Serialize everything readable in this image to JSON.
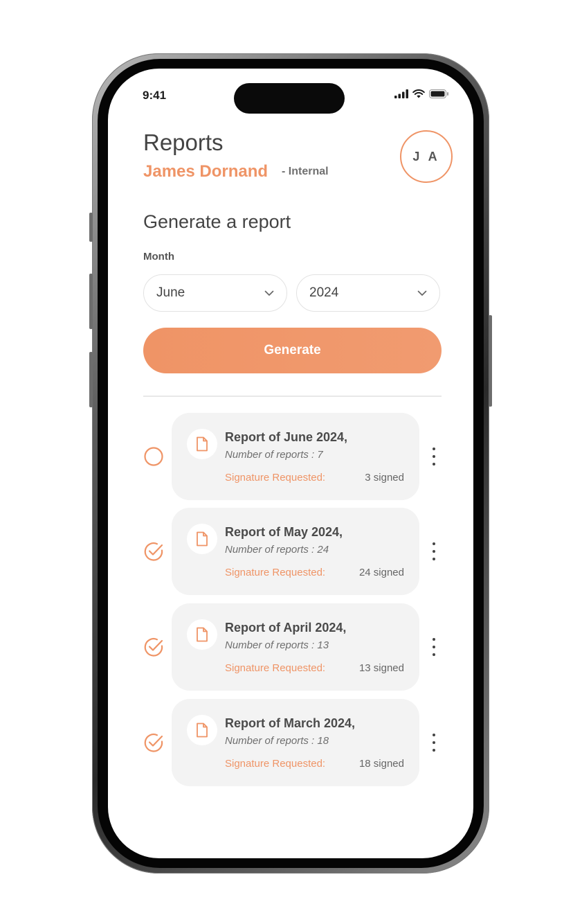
{
  "status_bar": {
    "time": "9:41"
  },
  "header": {
    "title": "Reports",
    "user_name": "James Dornand",
    "user_role": "- Internal",
    "avatar_initials": "J A"
  },
  "generate": {
    "section_title": "Generate a report",
    "month_label": "Month",
    "month_value": "June",
    "year_value": "2024",
    "button_label": "Generate"
  },
  "reports": [
    {
      "title": "Report of June 2024,",
      "count": "Number of reports : 7",
      "signature_label": "Signature Requested:",
      "signed": "3 signed",
      "checked": false
    },
    {
      "title": "Report of May 2024,",
      "count": "Number of reports : 24",
      "signature_label": "Signature Requested:",
      "signed": "24 signed",
      "checked": true
    },
    {
      "title": "Report of April 2024,",
      "count": "Number of reports : 13",
      "signature_label": "Signature Requested:",
      "signed": "13 signed",
      "checked": true
    },
    {
      "title": "Report of March 2024,",
      "count": "Number of reports : 18",
      "signature_label": "Signature Requested:",
      "signed": "18 signed",
      "checked": true
    }
  ],
  "colors": {
    "accent": "#ef9466",
    "card": "#f3f3f3",
    "text": "#444444"
  },
  "icons": [
    "signal-icon",
    "wifi-icon",
    "battery-icon",
    "chevron-down-icon",
    "document-icon",
    "circle-check-icon",
    "empty-circle-icon",
    "more-vertical-icon"
  ]
}
